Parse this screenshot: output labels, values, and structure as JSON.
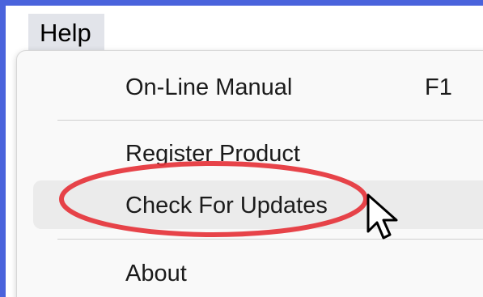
{
  "menubar": {
    "items": [
      {
        "label": "Help"
      }
    ]
  },
  "help_menu": {
    "items": [
      {
        "label": "On-Line Manual",
        "accelerator": "F1"
      },
      {
        "label": "Register Product"
      },
      {
        "label": "Check For Updates",
        "state": "hovered"
      },
      {
        "label": "About"
      }
    ]
  },
  "annotation": {
    "shape": "ellipse",
    "color": "#e5333a"
  },
  "cursor": {
    "icon": "arrow-pointer"
  },
  "colors": {
    "window_border": "#4a63dc",
    "menu_background": "#f9f9f9",
    "hover_background": "#ebebeb"
  }
}
